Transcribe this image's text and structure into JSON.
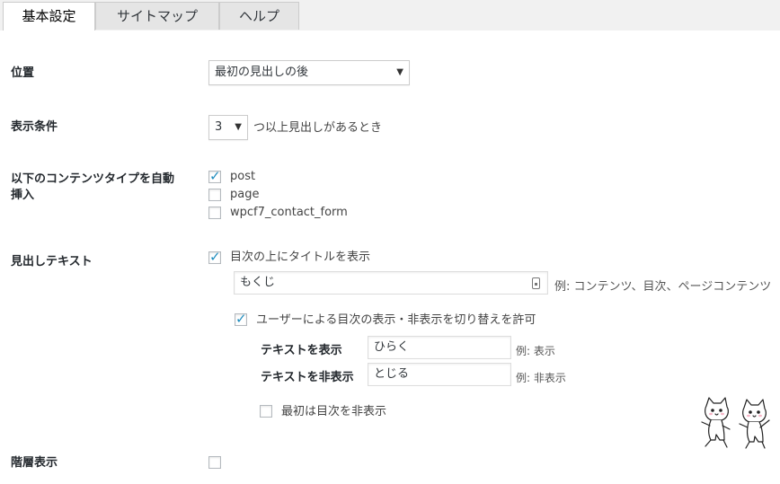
{
  "tabs": [
    {
      "label": "基本設定",
      "active": true
    },
    {
      "label": "サイトマップ",
      "active": false
    },
    {
      "label": "ヘルプ",
      "active": false
    }
  ],
  "position": {
    "label": "位置",
    "selected": "最初の見出しの後"
  },
  "display_condition": {
    "label": "表示条件",
    "selected": "3",
    "suffix": "つ以上見出しがあるとき"
  },
  "auto_insert": {
    "label_line1": "以下のコンテンツタイプを自動",
    "label_line2": "挿入",
    "types": [
      {
        "label": "post",
        "checked": true
      },
      {
        "label": "page",
        "checked": false
      },
      {
        "label": "wpcf7_contact_form",
        "checked": false
      }
    ]
  },
  "heading_text": {
    "label": "見出しテキスト",
    "show_title_label": "目次の上にタイトルを表示",
    "show_title_checked": true,
    "title_value": "もくじ",
    "title_hint": "例: コンテンツ、目次、ページコンテンツ",
    "toggle_label": "ユーザーによる目次の表示・非表示を切り替えを許可",
    "toggle_checked": true,
    "show_text_label": "テキストを表示",
    "show_text_value": "ひらく",
    "show_text_hint": "例: 表示",
    "hide_text_label": "テキストを非表示",
    "hide_text_value": "とじる",
    "hide_text_hint": "例: 非表示",
    "initially_hidden_label": "最初は目次を非表示",
    "initially_hidden_checked": false
  },
  "hierarchy": {
    "label": "階層表示",
    "checked": false
  },
  "colors": {
    "check": "#1e8cbe",
    "border": "#cccccc"
  }
}
